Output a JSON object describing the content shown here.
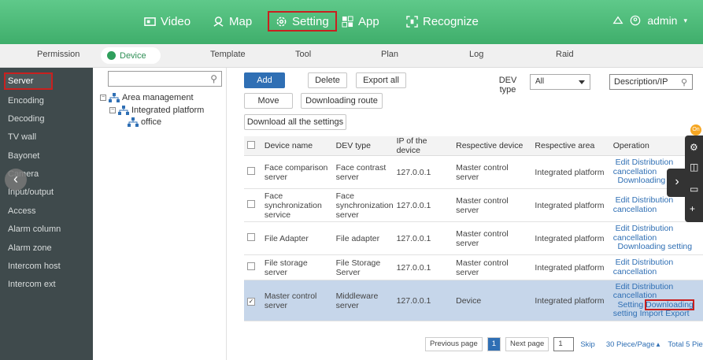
{
  "topnav": {
    "items": [
      {
        "label": "Video",
        "icon": "video-icon"
      },
      {
        "label": "Map",
        "icon": "map-icon"
      },
      {
        "label": "Setting",
        "icon": "gear-icon"
      },
      {
        "label": "App",
        "icon": "app-grid-icon"
      },
      {
        "label": "Recognize",
        "icon": "recognize-icon"
      }
    ],
    "user": "admin"
  },
  "subtabs": [
    "Permission",
    "Device",
    "Template",
    "Tool",
    "Plan",
    "Log",
    "Raid"
  ],
  "sidebar": {
    "items": [
      "Server",
      "Encoding",
      "Decoding",
      "TV wall",
      "Bayonet",
      "Camera",
      "Input/output",
      "Access",
      "Alarm column",
      "Alarm zone",
      "Intercom host",
      "Intercom ext"
    ]
  },
  "tree": {
    "search_value": "",
    "nodes": [
      "Area management",
      "Integrated platform",
      "office"
    ]
  },
  "toolbar": {
    "add": "Add",
    "delete": "Delete",
    "export_all": "Export all",
    "move": "Move",
    "downloading_route": "Downloading route",
    "download_all": "Download all the settings",
    "dev_type_label": "DEV type",
    "dev_type_value": "All",
    "search_placeholder": "Description/IP"
  },
  "table": {
    "headers": [
      "Device name",
      "DEV type",
      "IP of the device",
      "Respective device",
      "Respective area",
      "Operation"
    ],
    "rows": [
      {
        "name": "Face comparison server",
        "type": "Face contrast server",
        "ip": "127.0.0.1",
        "device": "Master control server",
        "area": "Integrated platform",
        "checked": false,
        "ops": [
          "Edit",
          "Distribution",
          "cancellation",
          "Downloading"
        ]
      },
      {
        "name": "Face synchronization service",
        "type": "Face synchronization server",
        "ip": "127.0.0.1",
        "device": "Master control server",
        "area": "Integrated platform",
        "checked": false,
        "ops": [
          "Edit",
          "Distribution",
          "cancellation"
        ]
      },
      {
        "name": "File Adapter",
        "type": "File adapter",
        "ip": "127.0.0.1",
        "device": "Master control server",
        "area": "Integrated platform",
        "checked": false,
        "ops": [
          "Edit",
          "Distribution",
          "cancellation",
          "Downloading setting"
        ]
      },
      {
        "name": "File storage server",
        "type": "File Storage Server",
        "ip": "127.0.0.1",
        "device": "Master control server",
        "area": "Integrated platform",
        "checked": false,
        "ops": [
          "Edit",
          "Distribution",
          "cancellation"
        ]
      },
      {
        "name": "Master control server",
        "type": "Middleware server",
        "ip": "127.0.0.1",
        "device": "Device",
        "area": "Integrated platform",
        "checked": true,
        "ops": [
          "Edit",
          "Distribution",
          "cancellation",
          "Setting",
          "Downloading",
          "setting",
          "Import",
          "Export"
        ]
      }
    ]
  },
  "pager": {
    "previous": "Previous page",
    "current": "1",
    "next": "Next page",
    "jump_value": "1",
    "skip": "Skip",
    "per_page": "30 Piece/Page",
    "total": "Total 5 Piec"
  },
  "float": {
    "badge": "On"
  },
  "colors": {
    "header_green": "#3fae6b",
    "sidebar_bg": "#3f4a4c",
    "primary_blue": "#2f6fb4",
    "highlight_red": "#c9201f",
    "selected_row": "#c6d6ea"
  }
}
